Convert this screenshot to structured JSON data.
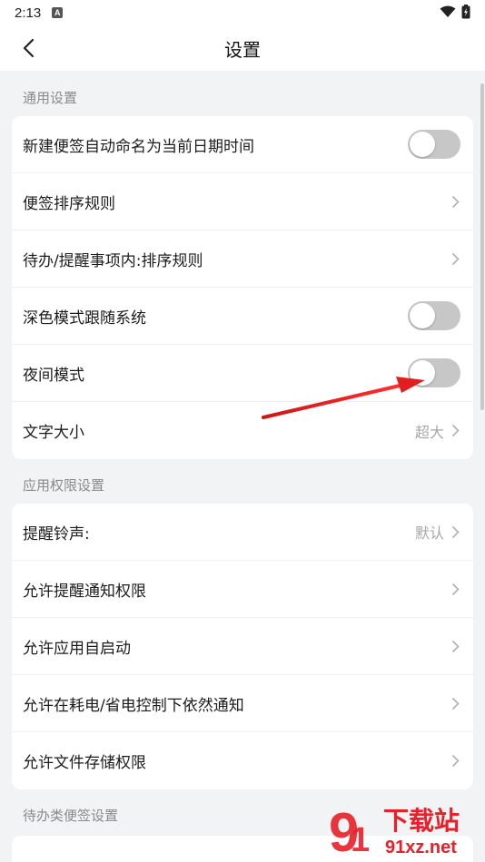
{
  "status_bar": {
    "time": "2:13",
    "notification_badge": "A"
  },
  "header": {
    "title": "设置"
  },
  "sections": [
    {
      "label": "通用设置",
      "rows": [
        {
          "label": "新建便签自动命名为当前日期时间",
          "type": "toggle",
          "on": false
        },
        {
          "label": "便签排序规则",
          "type": "link"
        },
        {
          "label": "待办/提醒事项内:排序规则",
          "type": "link"
        },
        {
          "label": "深色模式跟随系统",
          "type": "toggle",
          "on": false
        },
        {
          "label": "夜间模式",
          "type": "toggle",
          "on": false
        },
        {
          "label": "文字大小",
          "type": "link",
          "value": "超大"
        }
      ]
    },
    {
      "label": "应用权限设置",
      "rows": [
        {
          "label": "提醒铃声:",
          "type": "link",
          "value": "默认"
        },
        {
          "label": "允许提醒通知权限",
          "type": "link"
        },
        {
          "label": "允许应用自启动",
          "type": "link"
        },
        {
          "label": "允许在耗电/省电控制下依然通知",
          "type": "link"
        },
        {
          "label": "允许文件存储权限",
          "type": "link"
        }
      ]
    },
    {
      "label": "待办类便签设置",
      "rows": []
    }
  ],
  "watermark": {
    "line1": "下载站",
    "line2": "91xz.net"
  },
  "colors": {
    "accent_arrow": "#e02020",
    "toggle_off": "#c7c7c7",
    "watermark_red": "#e8202a"
  }
}
